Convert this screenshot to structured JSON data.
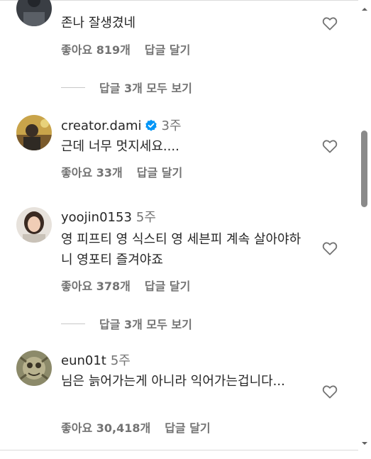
{
  "comments": [
    {
      "username": "",
      "verified": false,
      "time": "",
      "text": "존나 잘생겼네",
      "likes": "좋아요 819개",
      "reply": "답글 달기"
    },
    {
      "username": "creator.dami",
      "verified": true,
      "time": "3주",
      "text": "근데 너무 멋지세요....",
      "likes": "좋아요 33개",
      "reply": "답글 달기"
    },
    {
      "username": "yoojin0153",
      "verified": false,
      "time": "5주",
      "text": "영 피프티 영 식스티 영 세븐피 계속 살아야하니 영포티 즐겨야죠",
      "likes": "좋아요 378개",
      "reply": "답글 달기"
    },
    {
      "username": "eun01t",
      "verified": false,
      "time": "5주",
      "text": "님은 늙어가는게 아니라 익어가는겁니다...",
      "likes": "좋아요 30,418개",
      "reply": "답글 달기"
    }
  ],
  "view_replies": [
    {
      "label": "답글 3개 모두 보기"
    },
    {
      "label": "답글 3개 모두 보기"
    }
  ],
  "icons": {
    "heart": "heart-outline-icon",
    "verified": "verified-badge-icon"
  },
  "colors": {
    "text": "#262626",
    "secondary": "#737373",
    "verified": "#0095f6",
    "divider": "#c7c7c7"
  }
}
